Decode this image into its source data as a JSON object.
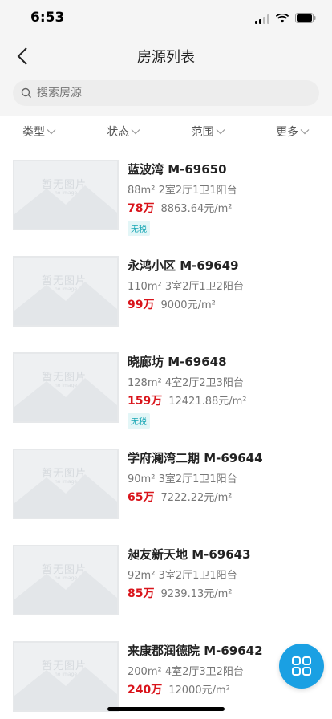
{
  "status_bar": {
    "time": "6:53"
  },
  "nav": {
    "title": "房源列表"
  },
  "search": {
    "placeholder": "搜索房源"
  },
  "filters": [
    "类型",
    "状态",
    "范围",
    "更多"
  ],
  "placeholder_image": {
    "text": "暂无图片",
    "subtext": "no image"
  },
  "listings": [
    {
      "title": "蓝波湾 M-69650",
      "area": "88m²",
      "layout": "2室2厅1卫1阳台",
      "price": "78万",
      "unit_price": "8863.64元/m²",
      "tag": "无税"
    },
    {
      "title": "永鸿小区 M-69649",
      "area": "110m²",
      "layout": "3室2厅1卫2阳台",
      "price": "99万",
      "unit_price": "9000元/m²",
      "tag": ""
    },
    {
      "title": "晓廊坊 M-69648",
      "area": "128m²",
      "layout": "4室2厅2卫3阳台",
      "price": "159万",
      "unit_price": "12421.88元/m²",
      "tag": "无税"
    },
    {
      "title": "学府澜湾二期 M-69644",
      "area": "90m²",
      "layout": "3室2厅1卫1阳台",
      "price": "65万",
      "unit_price": "7222.22元/m²",
      "tag": ""
    },
    {
      "title": "昶友新天地 M-69643",
      "area": "92m²",
      "layout": "3室2厅1卫1阳台",
      "price": "85万",
      "unit_price": "9239.13元/m²",
      "tag": ""
    },
    {
      "title": "来康郡润德院 M-69642",
      "area": "200m²",
      "layout": "4室2厅3卫2阳台",
      "price": "240万",
      "unit_price": "12000元/m²",
      "tag": ""
    }
  ],
  "colors": {
    "price": "#d9141b",
    "accent": "#1aa0e3",
    "tag": "#1aa7b5"
  },
  "icons": {
    "back": "chevron-left-icon",
    "search": "search-icon",
    "filter": "chevron-down-icon",
    "fab": "grid-icon"
  }
}
